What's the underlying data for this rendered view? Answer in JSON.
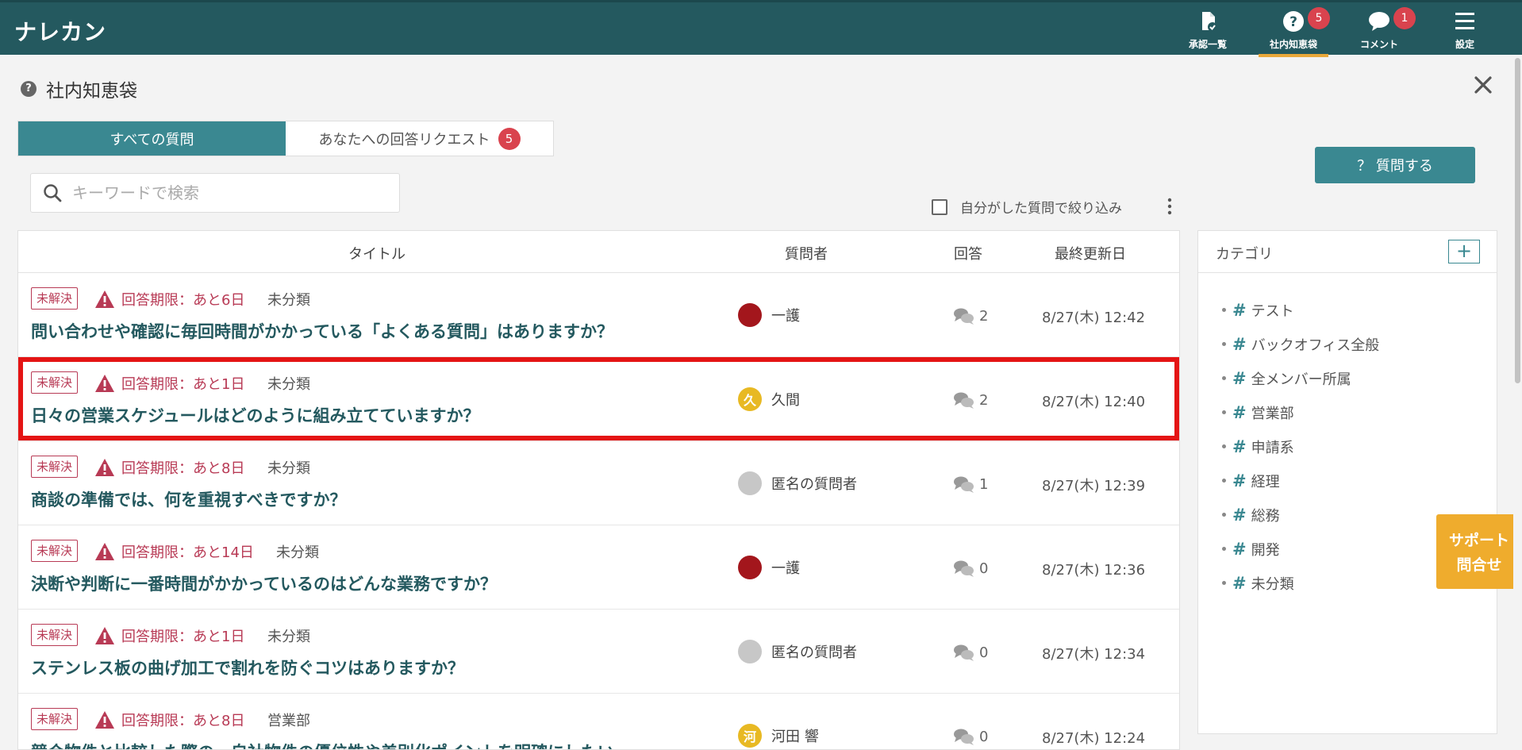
{
  "header": {
    "logo": "ナレカン",
    "nav": [
      {
        "label": "承認一覧",
        "icon": "approval-doc-icon"
      },
      {
        "label": "社内知恵袋",
        "icon": "question-circle-icon",
        "badge": "5",
        "active": true
      },
      {
        "label": "コメント",
        "icon": "comment-bubble-icon",
        "badge": "1"
      },
      {
        "label": "設定",
        "icon": "hamburger-menu-icon"
      }
    ]
  },
  "page": {
    "title": "社内知恵袋",
    "heading_icon": "?"
  },
  "tabs": {
    "all_label": "すべての質問",
    "requests_label": "あなたへの回答リクエスト",
    "requests_badge": "5"
  },
  "ask_button": "？ 質問する",
  "search": {
    "placeholder": "キーワードで検索",
    "value": ""
  },
  "filter": {
    "label": "自分がした質問で絞り込み",
    "checked": false
  },
  "table": {
    "headers": {
      "title": "タイトル",
      "asker": "質問者",
      "answers": "回答",
      "updated": "最終更新日"
    },
    "rows": [
      {
        "status": "未解決",
        "deadline": "回答期限：あと6日",
        "category": "未分類",
        "title": "問い合わせや確認に毎回時間がかかっている「よくある質問」はありますか？",
        "asker": "一護",
        "avatar": "",
        "avatar_color": "#a3161c",
        "answers": "2",
        "updated": "8/27(木) 12:42"
      },
      {
        "status": "未解決",
        "deadline": "回答期限：あと1日",
        "category": "未分類",
        "title": "日々の営業スケジュールはどのように組み立てていますか？",
        "asker": "久間",
        "avatar": "久",
        "avatar_color": "#e8b923",
        "answers": "2",
        "updated": "8/27(木) 12:40",
        "highlighted": true
      },
      {
        "status": "未解決",
        "deadline": "回答期限：あと8日",
        "category": "未分類",
        "title": "商談の準備では、何を重視すべきですか？",
        "asker": "匿名の質問者",
        "avatar": "",
        "avatar_color": "#c7c7c7",
        "answers": "1",
        "updated": "8/27(木) 12:39"
      },
      {
        "status": "未解決",
        "deadline": "回答期限：あと14日",
        "category": "未分類",
        "title": "決断や判断に一番時間がかかっているのはどんな業務ですか？",
        "asker": "一護",
        "avatar": "",
        "avatar_color": "#a3161c",
        "answers": "0",
        "updated": "8/27(木) 12:36"
      },
      {
        "status": "未解決",
        "deadline": "回答期限：あと1日",
        "category": "未分類",
        "title": "ステンレス板の曲げ加工で割れを防ぐコツはありますか？",
        "asker": "匿名の質問者",
        "avatar": "",
        "avatar_color": "#c7c7c7",
        "answers": "0",
        "updated": "8/27(木) 12:34"
      },
      {
        "status": "未解決",
        "deadline": "回答期限：あと8日",
        "category": "営業部",
        "title": "競合物件と比較した際の、自社物件の優位性や差別化ポイントを明確にしたい",
        "asker": "河田 響",
        "avatar": "河",
        "avatar_color": "#e8b923",
        "answers": "0",
        "updated": "8/27(木) 12:24"
      }
    ]
  },
  "categories": {
    "title": "カテゴリ",
    "add_label": "+",
    "items": [
      "テスト",
      "バックオフィス全般",
      "全メンバー所属",
      "営業部",
      "申請系",
      "経理",
      "総務",
      "開発",
      "未分類"
    ]
  },
  "support": {
    "line1": "サポート",
    "line2": "問合せ"
  },
  "colors": {
    "header": "#24595f",
    "accent": "#3a8891",
    "badge": "#d9434e",
    "status": "#b83a55",
    "highlight": "#e41414",
    "support": "#efac2d"
  }
}
